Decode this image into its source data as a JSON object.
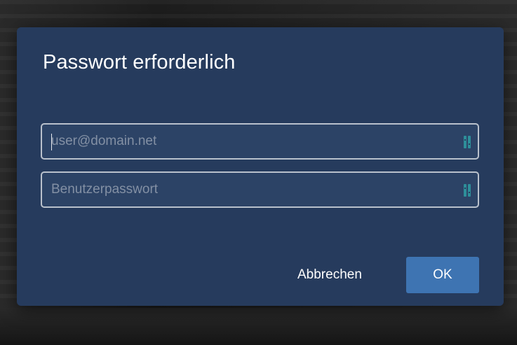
{
  "dialog": {
    "title": "Passwort erforderlich",
    "username": {
      "value": "",
      "placeholder": "user@domain.net",
      "icon": "password-manager-icon"
    },
    "password": {
      "value": "",
      "placeholder": "Benutzerpasswort",
      "icon": "password-manager-icon"
    },
    "cancel_label": "Abbrechen",
    "ok_label": "OK"
  },
  "colors": {
    "dialog_background": "#263b5d",
    "field_border": "#b9c1cc",
    "primary_button": "#3e74b2",
    "icon_accent": "#2e8f9a"
  }
}
